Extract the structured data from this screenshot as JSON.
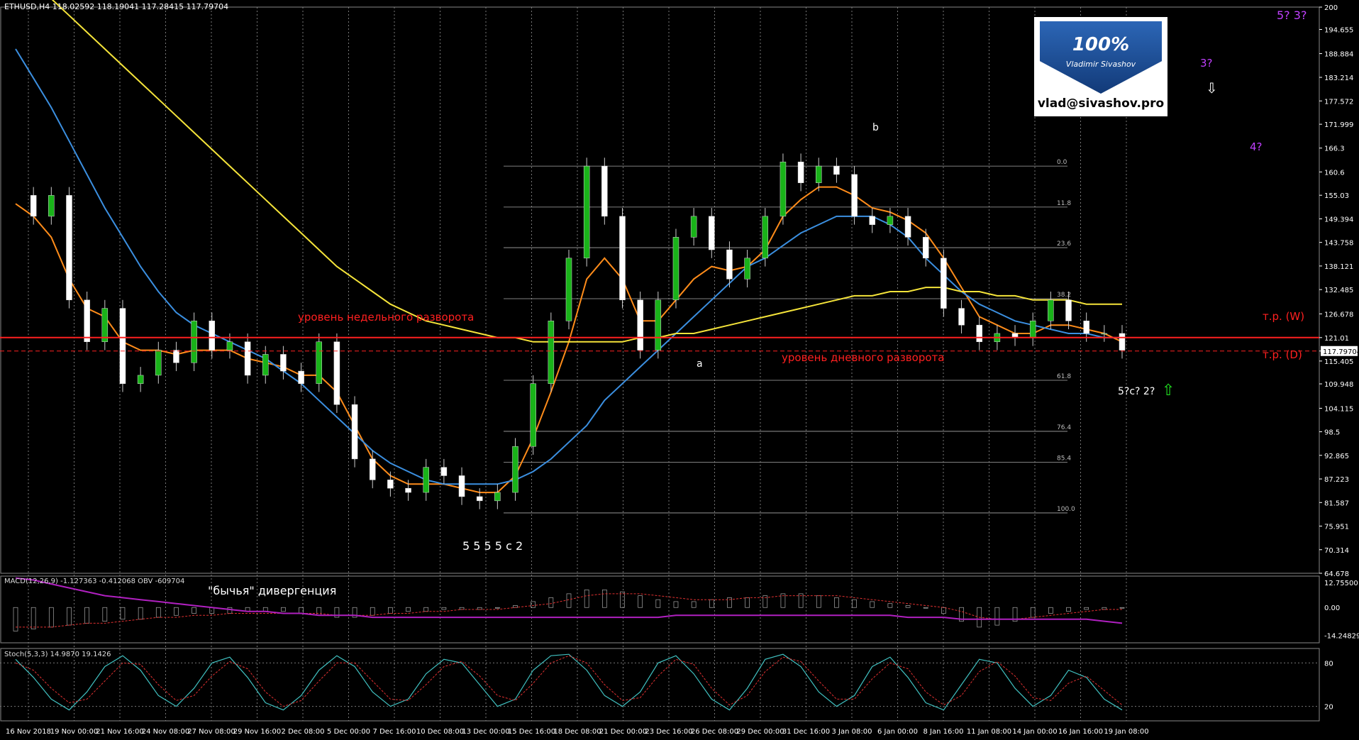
{
  "instrument_header": "ETHUSD,H4  118.02592 118.19041 117.28415 117.79704",
  "badge": {
    "percent": "100%",
    "name": "Vladimir Sivashov",
    "email": "vlad@sivashov.pro"
  },
  "annotations": {
    "weekly_level": "уровень недельного разворота",
    "daily_level": "уровень дневного разворота",
    "tp_w": "т.р. (W)",
    "tp_d": "т.р. (D)",
    "divergence": "\"бычья\" дивергенция"
  },
  "wave_labels": {
    "w53": "5? 3?",
    "w3q": "3?",
    "w4q": "4?",
    "w5c2": "5?c? 2?",
    "w555c2": "5 5 5 5 c 2",
    "b": "b",
    "a": "a"
  },
  "macd_header": "MACD(12,26,9) -1.127363 -0.412068  OBV -609704",
  "stoch_header": "Stoch(5,3,3) 14.9870 19.1426",
  "chart_data": {
    "type": "line",
    "title": "ETHUSD,H4",
    "price_ticks": [
      200.0,
      194.655,
      188.884,
      183.214,
      177.572,
      171.999,
      166.3,
      160.6,
      155.03,
      149.394,
      143.758,
      138.121,
      132.485,
      126.678,
      121.01,
      117.797,
      115.405,
      109.948,
      104.115,
      98.5,
      92.865,
      87.223,
      81.587,
      75.951,
      70.314,
      64.678
    ],
    "price_range": [
      64.678,
      200.0
    ],
    "x_labels": [
      "16 Nov 2018",
      "19 Nov 00:00",
      "21 Nov 16:00",
      "24 Nov 08:00",
      "27 Nov 08:00",
      "29 Nov 16:00",
      "2 Dec 08:00",
      "5 Dec 00:00",
      "7 Dec 16:00",
      "10 Dec 08:00",
      "13 Dec 00:00",
      "15 Dec 16:00",
      "18 Dec 08:00",
      "21 Dec 00:00",
      "23 Dec 16:00",
      "26 Dec 08:00",
      "29 Dec 00:00",
      "31 Dec 16:00",
      "3 Jan 08:00",
      "6 Jan 00:00",
      "8 Jan 16:00",
      "11 Jan 08:00",
      "14 Jan 00:00",
      "16 Jan 16:00",
      "19 Jan 08:00"
    ],
    "fib_levels": [
      {
        "label": "0.0",
        "price": 162.0
      },
      {
        "label": "11.8",
        "price": 152.2
      },
      {
        "label": "23.6",
        "price": 142.5
      },
      {
        "label": "38.2",
        "price": 130.3
      },
      {
        "label": "61.8",
        "price": 110.8
      },
      {
        "label": "76.4",
        "price": 98.6
      },
      {
        "label": "85.4",
        "price": 91.2
      },
      {
        "label": "100.0",
        "price": 79.1
      }
    ],
    "levels": [
      {
        "name": "weekly",
        "price": 121.01
      },
      {
        "name": "daily",
        "price": 117.8
      }
    ],
    "last_price": 117.79704,
    "series": [
      {
        "name": "close",
        "color": "#ffffff",
        "values": [
          155,
          150,
          155,
          130,
          120,
          128,
          110,
          112,
          118,
          115,
          125,
          118,
          120,
          112,
          117,
          113,
          110,
          120,
          105,
          92,
          87,
          85,
          84,
          90,
          88,
          83,
          82,
          84,
          95,
          110,
          125,
          140,
          162,
          150,
          130,
          118,
          130,
          145,
          150,
          142,
          135,
          140,
          150,
          163,
          158,
          162,
          160,
          150,
          148,
          150,
          145,
          140,
          128,
          124,
          120,
          122,
          121,
          125,
          130,
          125,
          122,
          122,
          118
        ]
      },
      {
        "name": "ma_fast",
        "color": "#ff8c1a",
        "values": [
          153,
          150,
          145,
          135,
          128,
          126,
          120,
          118,
          118,
          117,
          118,
          118,
          118,
          116,
          115,
          114,
          112,
          112,
          108,
          100,
          92,
          88,
          86,
          86,
          86,
          85,
          84,
          84,
          88,
          97,
          108,
          120,
          135,
          140,
          135,
          125,
          125,
          130,
          135,
          138,
          137,
          138,
          142,
          150,
          154,
          157,
          157,
          155,
          152,
          151,
          149,
          146,
          140,
          133,
          126,
          124,
          122,
          122,
          124,
          124,
          123,
          122,
          120
        ]
      },
      {
        "name": "ma_mid",
        "color": "#3b8fe0",
        "values": [
          190,
          183,
          176,
          168,
          160,
          152,
          145,
          138,
          132,
          127,
          124,
          122,
          120,
          118,
          116,
          113,
          110,
          106,
          102,
          98,
          94,
          91,
          89,
          87,
          86,
          86,
          86,
          86,
          87,
          89,
          92,
          96,
          100,
          106,
          110,
          114,
          118,
          122,
          126,
          130,
          134,
          138,
          140,
          143,
          146,
          148,
          150,
          150,
          150,
          148,
          145,
          140,
          136,
          132,
          129,
          127,
          125,
          124,
          123,
          122,
          122,
          121,
          121
        ]
      },
      {
        "name": "ma_slow",
        "color": "#f5e43a",
        "values": [
          210,
          206,
          202,
          198,
          194,
          190,
          186,
          182,
          178,
          174,
          170,
          166,
          162,
          158,
          154,
          150,
          146,
          142,
          138,
          135,
          132,
          129,
          127,
          125,
          124,
          123,
          122,
          121,
          121,
          120,
          120,
          120,
          120,
          120,
          120,
          121,
          121,
          122,
          122,
          123,
          124,
          125,
          126,
          127,
          128,
          129,
          130,
          131,
          131,
          132,
          132,
          133,
          133,
          132,
          132,
          131,
          131,
          130,
          130,
          130,
          129,
          129,
          129
        ]
      }
    ],
    "macd": {
      "y_ticks": [
        12.755,
        0.0,
        -14.248297
      ],
      "y_range": [
        -18,
        16
      ],
      "hist": [
        -12,
        -11,
        -10,
        -9,
        -8,
        -7,
        -6,
        -6,
        -5,
        -4,
        -3,
        -3,
        -3,
        -2,
        -2,
        -2,
        -3,
        -4,
        -5,
        -5,
        -4,
        -3,
        -2,
        -2,
        -1,
        -1,
        -1,
        0,
        1,
        3,
        5,
        7,
        9,
        9,
        8,
        6,
        4,
        3,
        3,
        4,
        5,
        5,
        6,
        7,
        7,
        6,
        5,
        4,
        3,
        2,
        1,
        0,
        -3,
        -7,
        -10,
        -9,
        -7,
        -5,
        -3,
        -2,
        -1,
        -1,
        0
      ],
      "signal": [
        -10,
        -10,
        -10,
        -9,
        -8,
        -8,
        -7,
        -6,
        -5,
        -5,
        -4,
        -4,
        -3,
        -3,
        -3,
        -3,
        -3,
        -3,
        -4,
        -4,
        -4,
        -3,
        -3,
        -2,
        -2,
        -1,
        -1,
        -1,
        0,
        1,
        2,
        4,
        6,
        7,
        7,
        7,
        6,
        5,
        4,
        4,
        4,
        5,
        5,
        6,
        6,
        6,
        6,
        5,
        4,
        3,
        2,
        1,
        0,
        -2,
        -5,
        -6,
        -6,
        -5,
        -4,
        -3,
        -2,
        -1,
        -1
      ],
      "obv": [
        15,
        14,
        12,
        10,
        8,
        6,
        5,
        4,
        3,
        2,
        1,
        0,
        -1,
        -2,
        -2,
        -3,
        -3,
        -4,
        -4,
        -4,
        -5,
        -5,
        -5,
        -5,
        -5,
        -5,
        -5,
        -5,
        -5,
        -5,
        -5,
        -5,
        -5,
        -5,
        -5,
        -5,
        -5,
        -4,
        -4,
        -4,
        -4,
        -4,
        -4,
        -4,
        -4,
        -4,
        -4,
        -4,
        -4,
        -4,
        -5,
        -5,
        -5,
        -6,
        -6,
        -6,
        -6,
        -6,
        -6,
        -6,
        -6,
        -7,
        -8
      ]
    },
    "stoch": {
      "y_ticks": [
        80,
        20
      ],
      "y_range": [
        0,
        100
      ],
      "k": [
        85,
        60,
        30,
        15,
        40,
        75,
        90,
        70,
        35,
        20,
        45,
        80,
        88,
        60,
        25,
        15,
        35,
        70,
        90,
        75,
        40,
        20,
        30,
        65,
        85,
        80,
        50,
        20,
        30,
        70,
        90,
        92,
        70,
        35,
        20,
        40,
        80,
        90,
        65,
        30,
        15,
        45,
        85,
        92,
        75,
        40,
        20,
        35,
        75,
        88,
        60,
        25,
        15,
        50,
        85,
        80,
        45,
        20,
        35,
        70,
        60,
        30,
        15
      ],
      "d": [
        80,
        70,
        45,
        25,
        30,
        55,
        80,
        78,
        50,
        28,
        35,
        62,
        82,
        72,
        40,
        20,
        28,
        55,
        80,
        80,
        55,
        30,
        28,
        50,
        75,
        82,
        62,
        35,
        28,
        52,
        80,
        90,
        80,
        50,
        28,
        32,
        62,
        85,
        78,
        45,
        22,
        35,
        68,
        88,
        82,
        55,
        30,
        30,
        58,
        80,
        72,
        40,
        22,
        35,
        68,
        82,
        62,
        32,
        28,
        52,
        62,
        42,
        22
      ]
    }
  }
}
